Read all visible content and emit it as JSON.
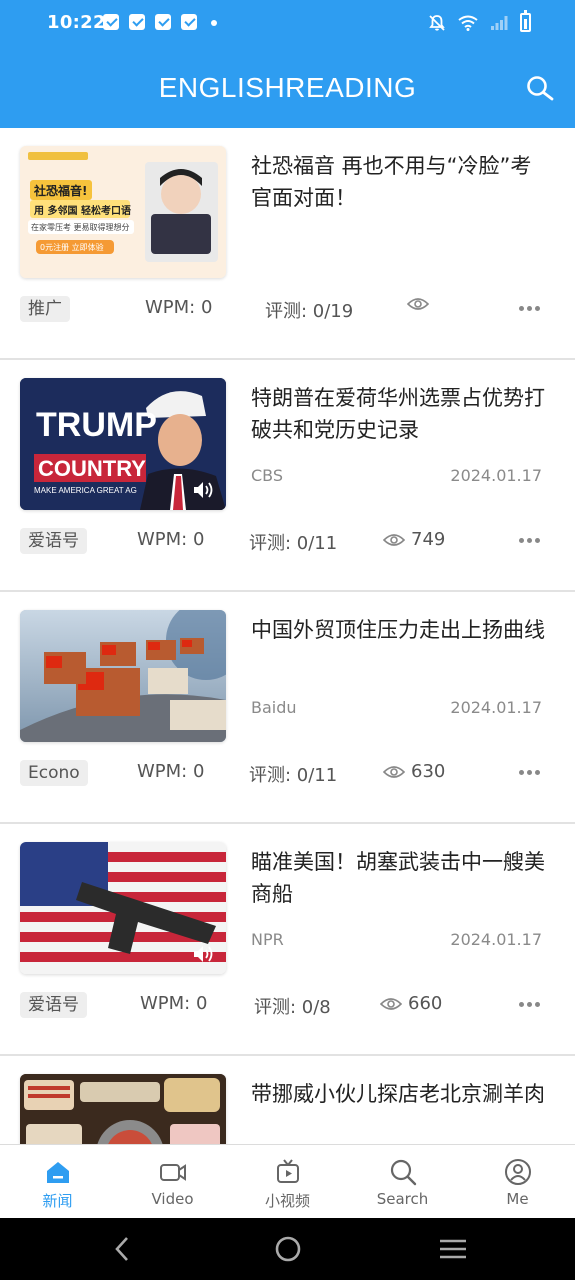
{
  "status_bar": {
    "time": "10:22"
  },
  "header": {
    "title": "ENGLISHREADING",
    "search_icon": "search-icon"
  },
  "articles": [
    {
      "headline": "社恐福音 再也不用与“冷脸”考官面对面！",
      "source": "",
      "date": "",
      "tag": "推广",
      "wpm": "WPM: 0",
      "score": "评测: 0/19",
      "views": "",
      "thumb_texts": [
        "社恐福音!",
        "用 多邻国 轻松考口语",
        "在家零压考 更易取得理想分",
        "0元注册 立即体验"
      ]
    },
    {
      "headline": "特朗普在爱荷华州选票占优势打破共和党历史记录",
      "source": "CBS",
      "date": "2024.01.17",
      "tag": "爱语号",
      "wpm": "WPM: 0",
      "score": "评测: 0/11",
      "views": "749",
      "thumb_texts": [
        "TRUMP",
        "COUNTRY",
        "MAKE AMERICA GREAT AG"
      ]
    },
    {
      "headline": "中国外贸顶住压力走出上扬曲线",
      "source": "Baidu",
      "date": "2024.01.17",
      "tag": "Econo",
      "wpm": "WPM: 0",
      "score": "评测: 0/11",
      "views": "630",
      "thumb_texts": []
    },
    {
      "headline": "瞄准美国！胡塞武装击中一艘美商船",
      "source": "NPR",
      "date": "2024.01.17",
      "tag": "爱语号",
      "wpm": "WPM: 0",
      "score": "评测: 0/8",
      "views": "660",
      "thumb_texts": []
    },
    {
      "headline": "带挪威小伙儿探店老北京涮羊肉",
      "source": "",
      "date": "",
      "tag": "",
      "wpm": "",
      "score": "",
      "views": "",
      "thumb_texts": []
    }
  ],
  "bottom_nav": [
    {
      "label": "新闻",
      "icon": "home-icon",
      "active": true
    },
    {
      "label": "Video",
      "icon": "video-camera-icon",
      "active": false
    },
    {
      "label": "小视频",
      "icon": "tv-play-icon",
      "active": false
    },
    {
      "label": "Search",
      "icon": "search-icon",
      "active": false
    },
    {
      "label": "Me",
      "icon": "user-icon",
      "active": false
    }
  ],
  "colors": {
    "accent": "#2e9df1",
    "text": "#222222",
    "muted": "#8a8a8a"
  }
}
